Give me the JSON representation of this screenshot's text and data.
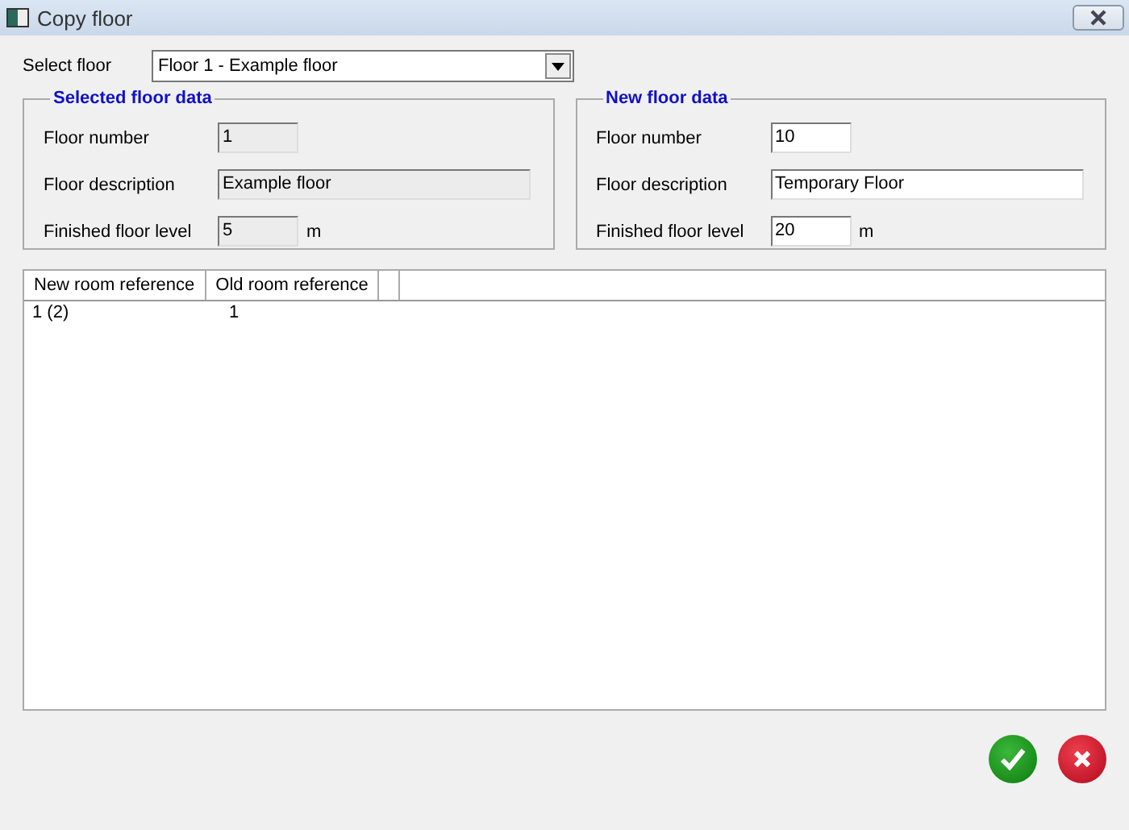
{
  "window": {
    "title": "Copy floor"
  },
  "select_floor": {
    "label": "Select floor",
    "value": "Floor  1 - Example floor"
  },
  "groups": [
    {
      "title": "Selected floor data",
      "fields": [
        {
          "label": "Floor number",
          "value": "1",
          "disabled": true,
          "kind": "narrow"
        },
        {
          "label": "Floor description",
          "value": "Example floor",
          "disabled": true,
          "kind": "wide"
        },
        {
          "label": "Finished floor level",
          "value": "5",
          "disabled": true,
          "kind": "narrow",
          "unit": "m"
        }
      ]
    },
    {
      "title": "New floor data",
      "fields": [
        {
          "label": "Floor number",
          "value": "10",
          "disabled": false,
          "kind": "narrow"
        },
        {
          "label": "Floor description",
          "value": "Temporary Floor",
          "disabled": false,
          "kind": "wide"
        },
        {
          "label": "Finished floor level",
          "value": "20",
          "disabled": false,
          "kind": "narrow",
          "unit": "m"
        }
      ]
    }
  ],
  "table": {
    "columns": [
      "New room reference",
      "Old room reference"
    ],
    "rows": [
      [
        "1 (2)",
        "1"
      ]
    ]
  }
}
